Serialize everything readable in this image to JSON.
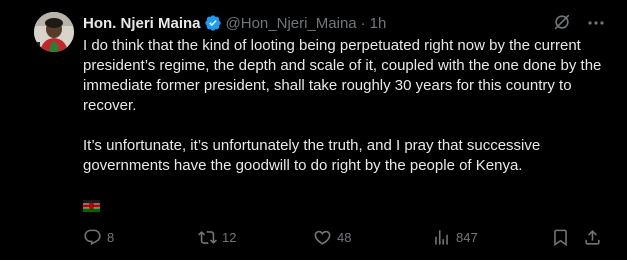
{
  "author": {
    "name": "Hon. Njeri Maina",
    "handle": "@Hon_Njeri_Maina",
    "separator": "·",
    "time": "1h"
  },
  "tweet": {
    "paragraph1": "I do think that the kind of looting being perpetuated right now by the current president’s regime, the depth and scale of it, coupled with the one done by the immediate former president, shall take roughly 30 years for this country to recover.",
    "paragraph2": "It’s unfortunate, it’s unfortunately the truth, and I pray that successive governments have the goodwill to do right by the people of Kenya."
  },
  "actions": {
    "reply_count": "8",
    "repost_count": "12",
    "like_count": "48",
    "view_count": "847"
  },
  "icons": {
    "verified": "verified-badge-icon",
    "grok": "grok-icon",
    "more": "more-icon",
    "flag": "kenya-flag-icon",
    "reply": "reply-icon",
    "repost": "repost-icon",
    "like": "like-icon",
    "views": "views-icon",
    "bookmark": "bookmark-icon",
    "share": "share-icon"
  },
  "colors": {
    "background": "#000000",
    "text": "#e7e9ea",
    "muted": "#71767b",
    "verified": "#1d9bf0"
  }
}
